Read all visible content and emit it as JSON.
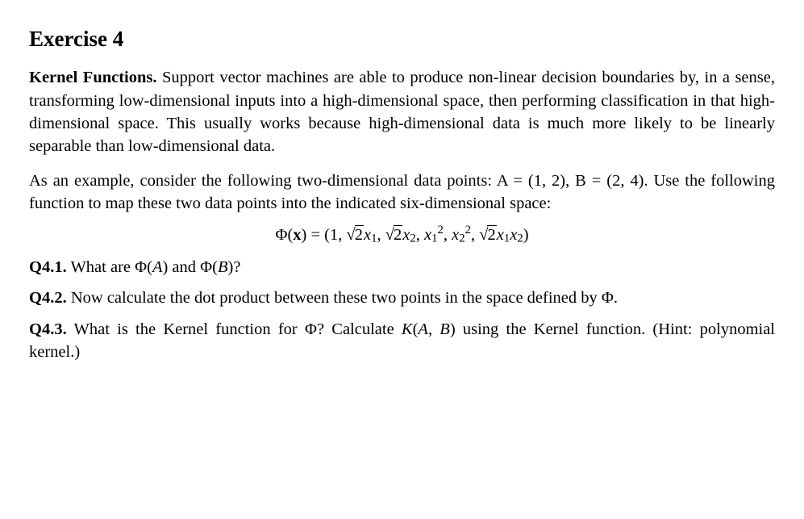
{
  "title": "Exercise 4",
  "intro_lead": "Kernel Functions.",
  "intro_body": " Support vector machines are able to produce non-linear decision boundaries by, in a sense, transforming low-dimensional inputs into a high-dimensional space, then performing classification in that high-dimensional space. This usually works because high-dimensional data is much more likely to be linearly separable than low-dimensional data.",
  "example_text": "As an example, consider the following two-dimensional data points: A = (1, 2), B = (2, 4). Use the following function to map these two data points into a six-dimensional space:",
  "phi_map": {
    "lhs": "Φ(x) = ",
    "terms": [
      "1",
      "√2 x₁",
      "√2 x₂",
      "x₁²",
      "x₂²",
      "√2 x₁x₂"
    ]
  },
  "q41": {
    "label": "Q4.1.",
    "text": " What are Φ(A) and Φ(B)?"
  },
  "q42": {
    "label": "Q4.2.",
    "text": " Now calculate the dot product between these two points in the space defined by Φ."
  },
  "q43": {
    "label": "Q4.3.",
    "text": " What is the Kernel function for Φ? Calculate K(A, B) using the Kernel function. (Hint: polynomial kernel.)"
  }
}
